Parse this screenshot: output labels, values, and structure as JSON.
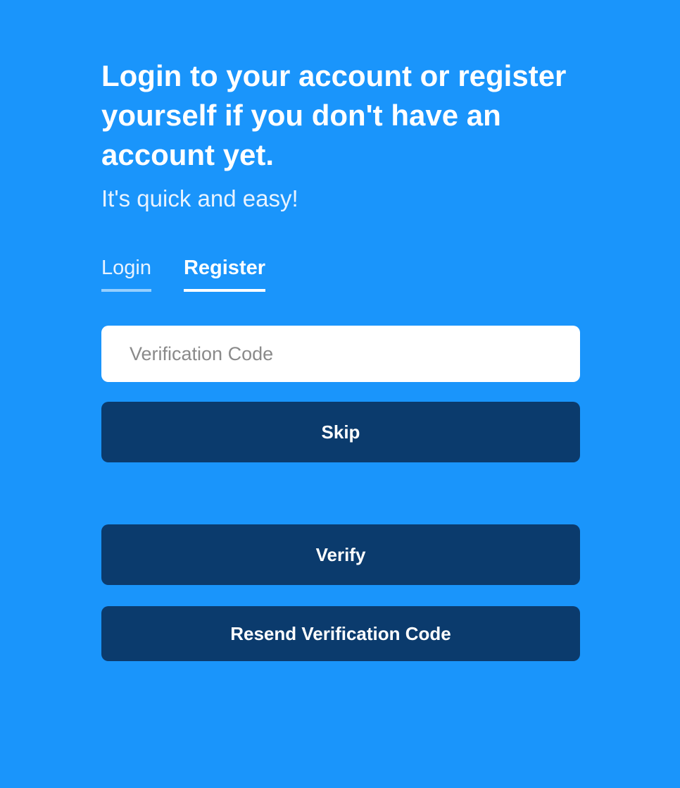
{
  "header": {
    "headline": "Login to your account or register yourself if you don't have an account yet.",
    "subtitle": "It's quick and easy!"
  },
  "tabs": [
    {
      "label": "Login",
      "active": false
    },
    {
      "label": "Register",
      "active": true
    }
  ],
  "form": {
    "verification_code": {
      "value": "",
      "placeholder": "Verification Code"
    },
    "skip_label": "Skip",
    "verify_label": "Verify",
    "resend_label": "Resend Verification Code"
  },
  "colors": {
    "background": "#1a95fb",
    "button": "#0b3b6d",
    "text": "#ffffff"
  }
}
